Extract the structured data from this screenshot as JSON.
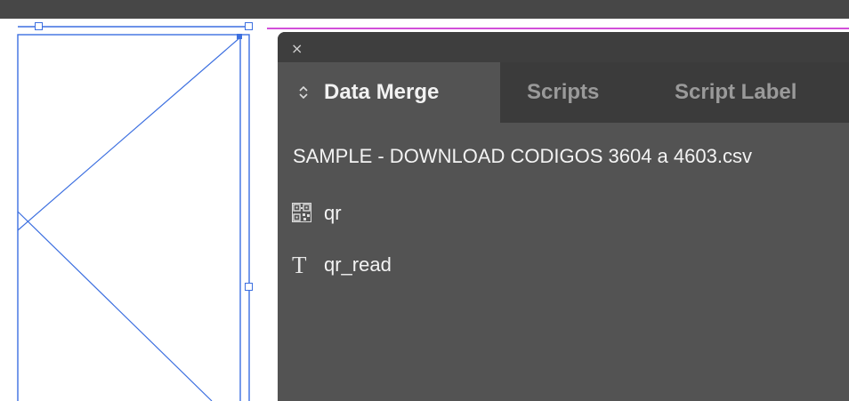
{
  "panel": {
    "close_label": "×",
    "tabs": [
      {
        "label": "Data Merge",
        "active": true
      },
      {
        "label": "Scripts",
        "active": false
      },
      {
        "label": "Script Label",
        "active": false
      }
    ],
    "data_source": "SAMPLE - DOWNLOAD CODIGOS 3604 a 4603.csv",
    "fields": [
      {
        "name": "qr",
        "icon": "image-field-icon"
      },
      {
        "name": "qr_read",
        "icon": "text-field-icon",
        "icon_glyph": "T"
      }
    ]
  },
  "colors": {
    "panel_bg": "#535353",
    "tabbar_bg": "#3b3b3b",
    "selection_blue": "#3c6fe0",
    "guide_magenta": "#d24fd9"
  }
}
